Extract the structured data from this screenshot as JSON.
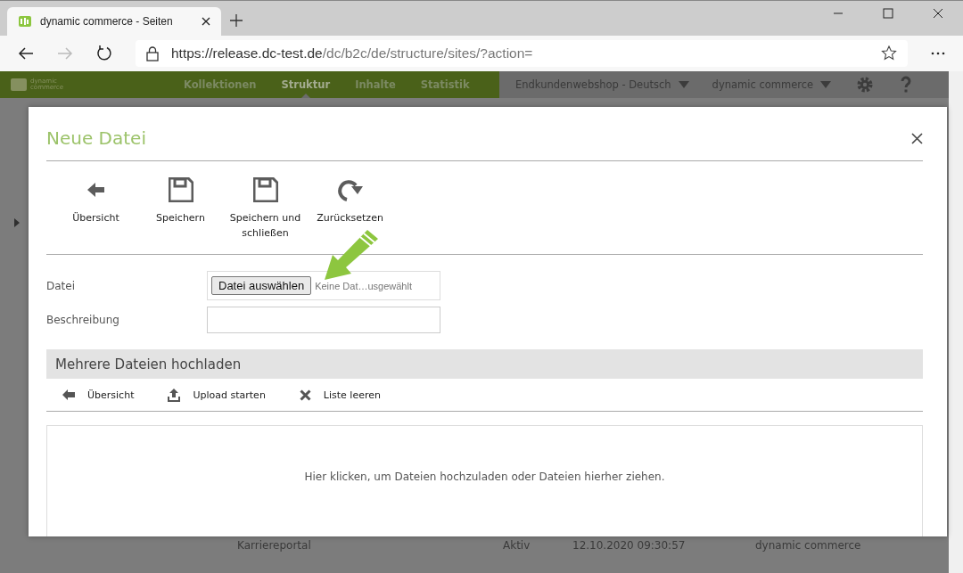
{
  "browser": {
    "tab_title": "dynamic commerce - Seiten",
    "url_host": "https://release.dc-test.de",
    "url_path": "/dc/b2c/de/structure/sites/?action="
  },
  "app_nav": {
    "logo_lines": [
      "dynamic",
      "commerce"
    ],
    "items": [
      {
        "label": "Kollektionen",
        "selected": false
      },
      {
        "label": "Struktur",
        "selected": true
      },
      {
        "label": "Inhalte",
        "selected": false
      },
      {
        "label": "Statistik",
        "selected": false
      }
    ],
    "dropdowns": [
      "Endkundenwebshop - Deutsch",
      "dynamic commerce"
    ]
  },
  "background_row": [
    "Karriereportal",
    "Aktiv",
    "12.10.2020 09:30:57",
    "dynamic commerce"
  ],
  "modal": {
    "title": "Neue Datei",
    "toolbar": [
      {
        "kind": "back",
        "label": "Übersicht"
      },
      {
        "kind": "save",
        "label": "Speichern"
      },
      {
        "kind": "save",
        "label": "Speichern und schließen"
      },
      {
        "kind": "reset",
        "label": "Zurücksetzen"
      }
    ],
    "file_field": {
      "label": "Datei",
      "button": "Datei auswählen",
      "status": "Keine Dat…usgewählt"
    },
    "description_field": {
      "label": "Beschreibung"
    },
    "section_title": "Mehrere Dateien hochladen",
    "actions": [
      {
        "kind": "back",
        "label": "Übersicht"
      },
      {
        "kind": "upload",
        "label": "Upload starten"
      },
      {
        "kind": "clear",
        "label": "Liste leeren"
      }
    ],
    "dropzone_text": "Hier klicken, um Dateien hochzuladen oder Dateien hierher ziehen."
  }
}
